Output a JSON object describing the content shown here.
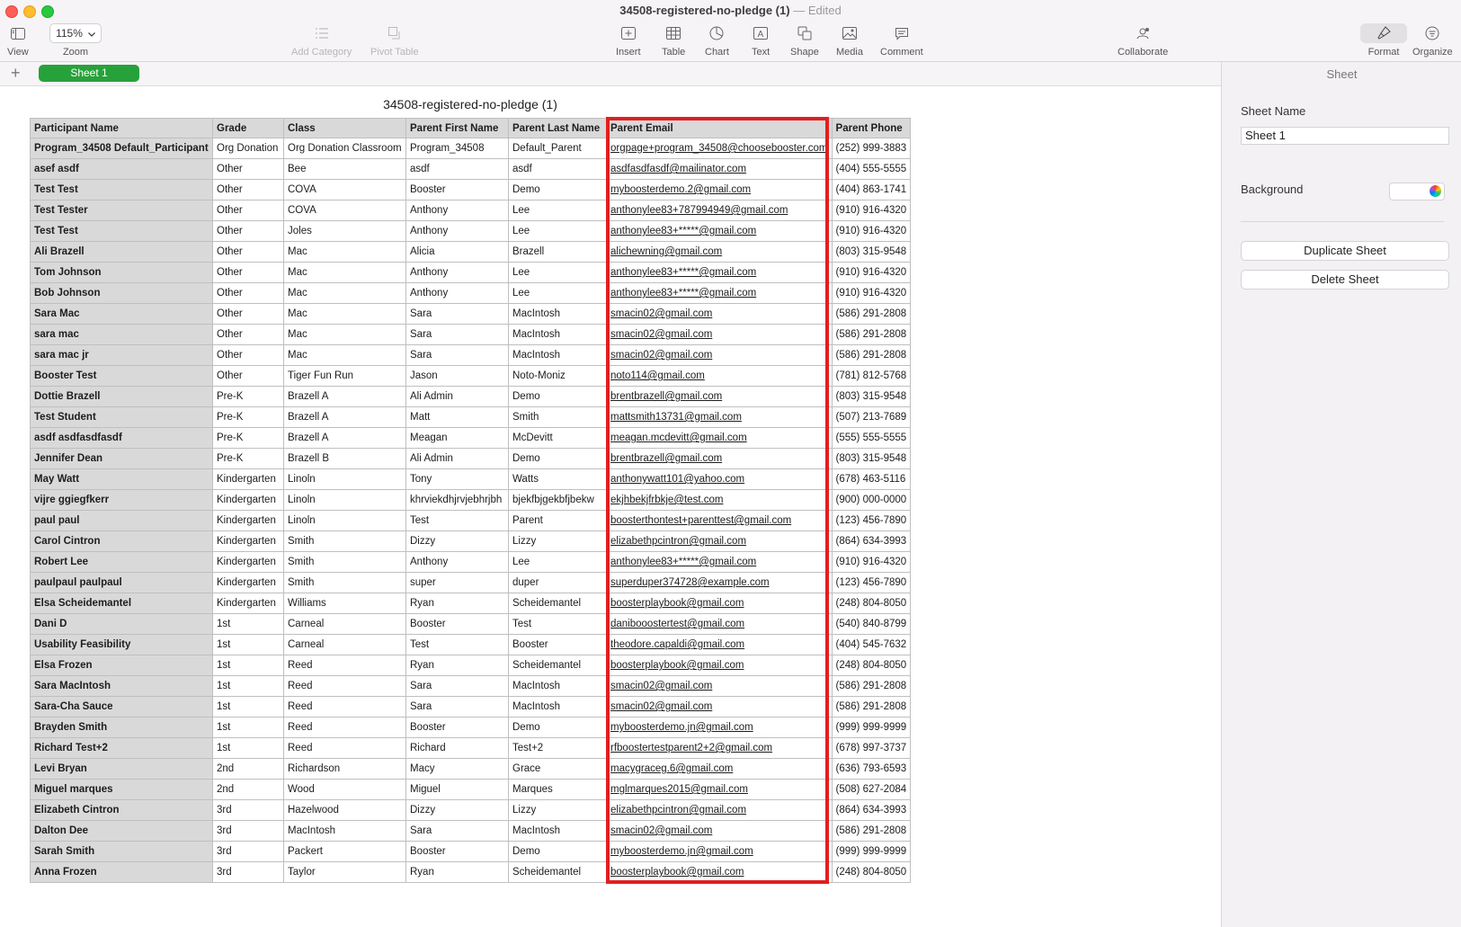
{
  "window": {
    "title": "34508-registered-no-pledge (1)",
    "title_sep": " — ",
    "status": "Edited"
  },
  "toolbar": {
    "view": "View",
    "zoom_value": "115%",
    "zoom": "Zoom",
    "add_category": "Add Category",
    "pivot_table": "Pivot Table",
    "insert": "Insert",
    "table": "Table",
    "chart": "Chart",
    "text": "Text",
    "shape": "Shape",
    "media": "Media",
    "comment": "Comment",
    "collaborate": "Collaborate",
    "format": "Format",
    "organize": "Organize"
  },
  "tabs": {
    "add": "+",
    "sheet1": "Sheet 1"
  },
  "sidebar": {
    "header": "Sheet",
    "sheet_name_label": "Sheet Name",
    "sheet_name_value": "Sheet 1",
    "background_label": "Background",
    "duplicate": "Duplicate Sheet",
    "delete": "Delete Sheet"
  },
  "table": {
    "title": "34508-registered-no-pledge (1)",
    "columns": [
      "Participant Name",
      "Grade",
      "Class",
      "Parent First Name",
      "Parent Last Name",
      "Parent Email",
      "Parent Phone"
    ],
    "rows": [
      [
        "Program_34508 Default_Participant",
        "Org Donation",
        "Org Donation Classroom",
        "Program_34508",
        "Default_Parent",
        "orgpage+program_34508@choosebooster.com",
        "(252) 999-3883"
      ],
      [
        "asef asdf",
        "Other",
        "Bee",
        "asdf",
        "asdf",
        "asdfasdfasdf@mailinator.com",
        "(404) 555-5555"
      ],
      [
        "Test Test",
        "Other",
        "COVA",
        "Booster",
        "Demo",
        "myboosterdemo.2@gmail.com",
        "(404) 863-1741"
      ],
      [
        "Test Tester",
        "Other",
        "COVA",
        "Anthony",
        "Lee",
        "anthonylee83+787994949@gmail.com",
        "(910) 916-4320"
      ],
      [
        "Test Test",
        "Other",
        "Joles",
        "Anthony",
        "Lee",
        "anthonylee83+*****@gmail.com",
        "(910) 916-4320"
      ],
      [
        "Ali Brazell",
        "Other",
        "Mac",
        "Alicia",
        "Brazell",
        "alichewning@gmail.com",
        "(803) 315-9548"
      ],
      [
        "Tom Johnson",
        "Other",
        "Mac",
        "Anthony",
        "Lee",
        "anthonylee83+*****@gmail.com",
        "(910) 916-4320"
      ],
      [
        "Bob Johnson",
        "Other",
        "Mac",
        "Anthony",
        "Lee",
        "anthonylee83+*****@gmail.com",
        "(910) 916-4320"
      ],
      [
        "Sara Mac",
        "Other",
        "Mac",
        "Sara",
        "MacIntosh",
        "smacin02@gmail.com",
        "(586) 291-2808"
      ],
      [
        "sara mac",
        "Other",
        "Mac",
        "Sara",
        "MacIntosh",
        "smacin02@gmail.com",
        "(586) 291-2808"
      ],
      [
        "sara mac jr",
        "Other",
        "Mac",
        "Sara",
        "MacIntosh",
        "smacin02@gmail.com",
        "(586) 291-2808"
      ],
      [
        "Booster Test",
        "Other",
        "Tiger Fun Run",
        "Jason",
        "Noto-Moniz",
        "noto114@gmail.com",
        "(781) 812-5768"
      ],
      [
        "Dottie Brazell",
        "Pre-K",
        "Brazell A",
        "Ali Admin",
        "Demo",
        "brentbrazell@gmail.com",
        "(803) 315-9548"
      ],
      [
        "Test Student",
        "Pre-K",
        "Brazell A",
        "Matt",
        "Smith",
        "mattsmith13731@gmail.com",
        "(507) 213-7689"
      ],
      [
        "asdf asdfasdfasdf",
        "Pre-K",
        "Brazell A",
        "Meagan",
        "McDevitt",
        "meagan.mcdevitt@gmail.com",
        "(555) 555-5555"
      ],
      [
        "Jennifer Dean",
        "Pre-K",
        "Brazell B",
        "Ali Admin",
        "Demo",
        "brentbrazell@gmail.com",
        "(803) 315-9548"
      ],
      [
        "May Watt",
        "Kindergarten",
        "Linoln",
        "Tony",
        "Watts",
        "anthonywatt101@yahoo.com",
        "(678) 463-5116"
      ],
      [
        "vijre ggiegfkerr",
        "Kindergarten",
        "Linoln",
        "khrviekdhjrvjebhrjbh",
        "bjekfbjgekbfjbekw",
        "ekjhbekjfrbkje@test.com",
        "(900) 000-0000"
      ],
      [
        "paul paul",
        "Kindergarten",
        "Linoln",
        "Test",
        "Parent",
        "boosterthontest+parenttest@gmail.com",
        "(123) 456-7890"
      ],
      [
        "Carol Cintron",
        "Kindergarten",
        "Smith",
        "Dizzy",
        "Lizzy",
        "elizabethpcintron@gmail.com",
        "(864) 634-3993"
      ],
      [
        "Robert Lee",
        "Kindergarten",
        "Smith",
        "Anthony",
        "Lee",
        "anthonylee83+*****@gmail.com",
        "(910) 916-4320"
      ],
      [
        "paulpaul paulpaul",
        "Kindergarten",
        "Smith",
        "super",
        "duper",
        "superduper374728@example.com",
        "(123) 456-7890"
      ],
      [
        "Elsa Scheidemantel",
        "Kindergarten",
        "Williams",
        "Ryan",
        "Scheidemantel",
        "boosterplaybook@gmail.com",
        "(248) 804-8050"
      ],
      [
        "Dani D",
        "1st",
        "Carneal",
        "Booster",
        "Test",
        "danibooostertest@gmail.com",
        "(540) 840-8799"
      ],
      [
        "Usability Feasibility",
        "1st",
        "Carneal",
        "Test",
        "Booster",
        "theodore.capaldi@gmail.com",
        "(404) 545-7632"
      ],
      [
        "Elsa Frozen",
        "1st",
        "Reed",
        "Ryan",
        "Scheidemantel",
        "boosterplaybook@gmail.com",
        "(248) 804-8050"
      ],
      [
        "Sara MacIntosh",
        "1st",
        "Reed",
        "Sara",
        "MacIntosh",
        "smacin02@gmail.com",
        "(586) 291-2808"
      ],
      [
        "Sara-Cha Sauce",
        "1st",
        "Reed",
        "Sara",
        "MacIntosh",
        "smacin02@gmail.com",
        "(586) 291-2808"
      ],
      [
        "Brayden Smith",
        "1st",
        "Reed",
        "Booster",
        "Demo",
        "myboosterdemo.jn@gmail.com",
        "(999) 999-9999"
      ],
      [
        "Richard Test+2",
        "1st",
        "Reed",
        "Richard",
        "Test+2",
        "rfboostertestparent2+2@gmail.com",
        "(678) 997-3737"
      ],
      [
        "Levi Bryan",
        "2nd",
        "Richardson",
        "Macy",
        "Grace",
        "macygraceg.6@gmail.com",
        "(636) 793-6593"
      ],
      [
        "Miguel marques",
        "2nd",
        "Wood",
        "Miguel",
        "Marques",
        "mglmarques2015@gmail.com",
        "(508) 627-2084"
      ],
      [
        "Elizabeth Cintron",
        "3rd",
        "Hazelwood",
        "Dizzy",
        "Lizzy",
        "elizabethpcintron@gmail.com",
        "(864) 634-3993"
      ],
      [
        "Dalton Dee",
        "3rd",
        "MacIntosh",
        "Sara",
        "MacIntosh",
        "smacin02@gmail.com",
        "(586) 291-2808"
      ],
      [
        "Sarah Smith",
        "3rd",
        "Packert",
        "Booster",
        "Demo",
        "myboosterdemo.jn@gmail.com",
        "(999) 999-9999"
      ],
      [
        "Anna Frozen",
        "3rd",
        "Taylor",
        "Ryan",
        "Scheidemantel",
        "boosterplaybook@gmail.com",
        "(248) 804-8050"
      ]
    ]
  },
  "colors": {
    "accent_green": "#27a23a",
    "highlight_red": "#e21f1f",
    "header_gray": "#d9d9d9"
  }
}
